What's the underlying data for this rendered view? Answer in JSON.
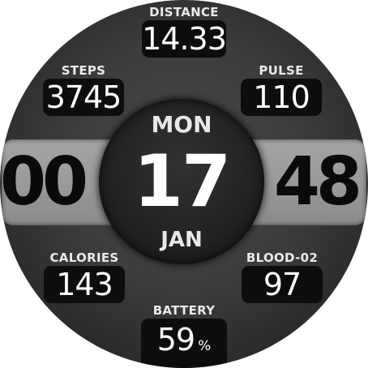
{
  "time": {
    "hours": "00",
    "minutes": "48"
  },
  "date": {
    "day_of_week": "MON",
    "day": "17",
    "month": "JAN"
  },
  "stats": {
    "distance": {
      "label": "DISTANCE",
      "value": "14.33"
    },
    "steps": {
      "label": "STEPS",
      "value": "3745"
    },
    "pulse": {
      "label": "PULSE",
      "value": "110"
    },
    "calories": {
      "label": "CALORIES",
      "value": "143"
    },
    "blood_o2": {
      "label": "BLOOD-02",
      "value": "97"
    },
    "battery": {
      "label": "BATTERY",
      "value": "59",
      "unit": "%"
    }
  },
  "colors": {
    "face_background": "#3c3c3c",
    "time_band": "#9a9a9a",
    "time_text": "#0a0a0a",
    "stat_box": "#0d0d0d",
    "text": "#ffffff"
  }
}
